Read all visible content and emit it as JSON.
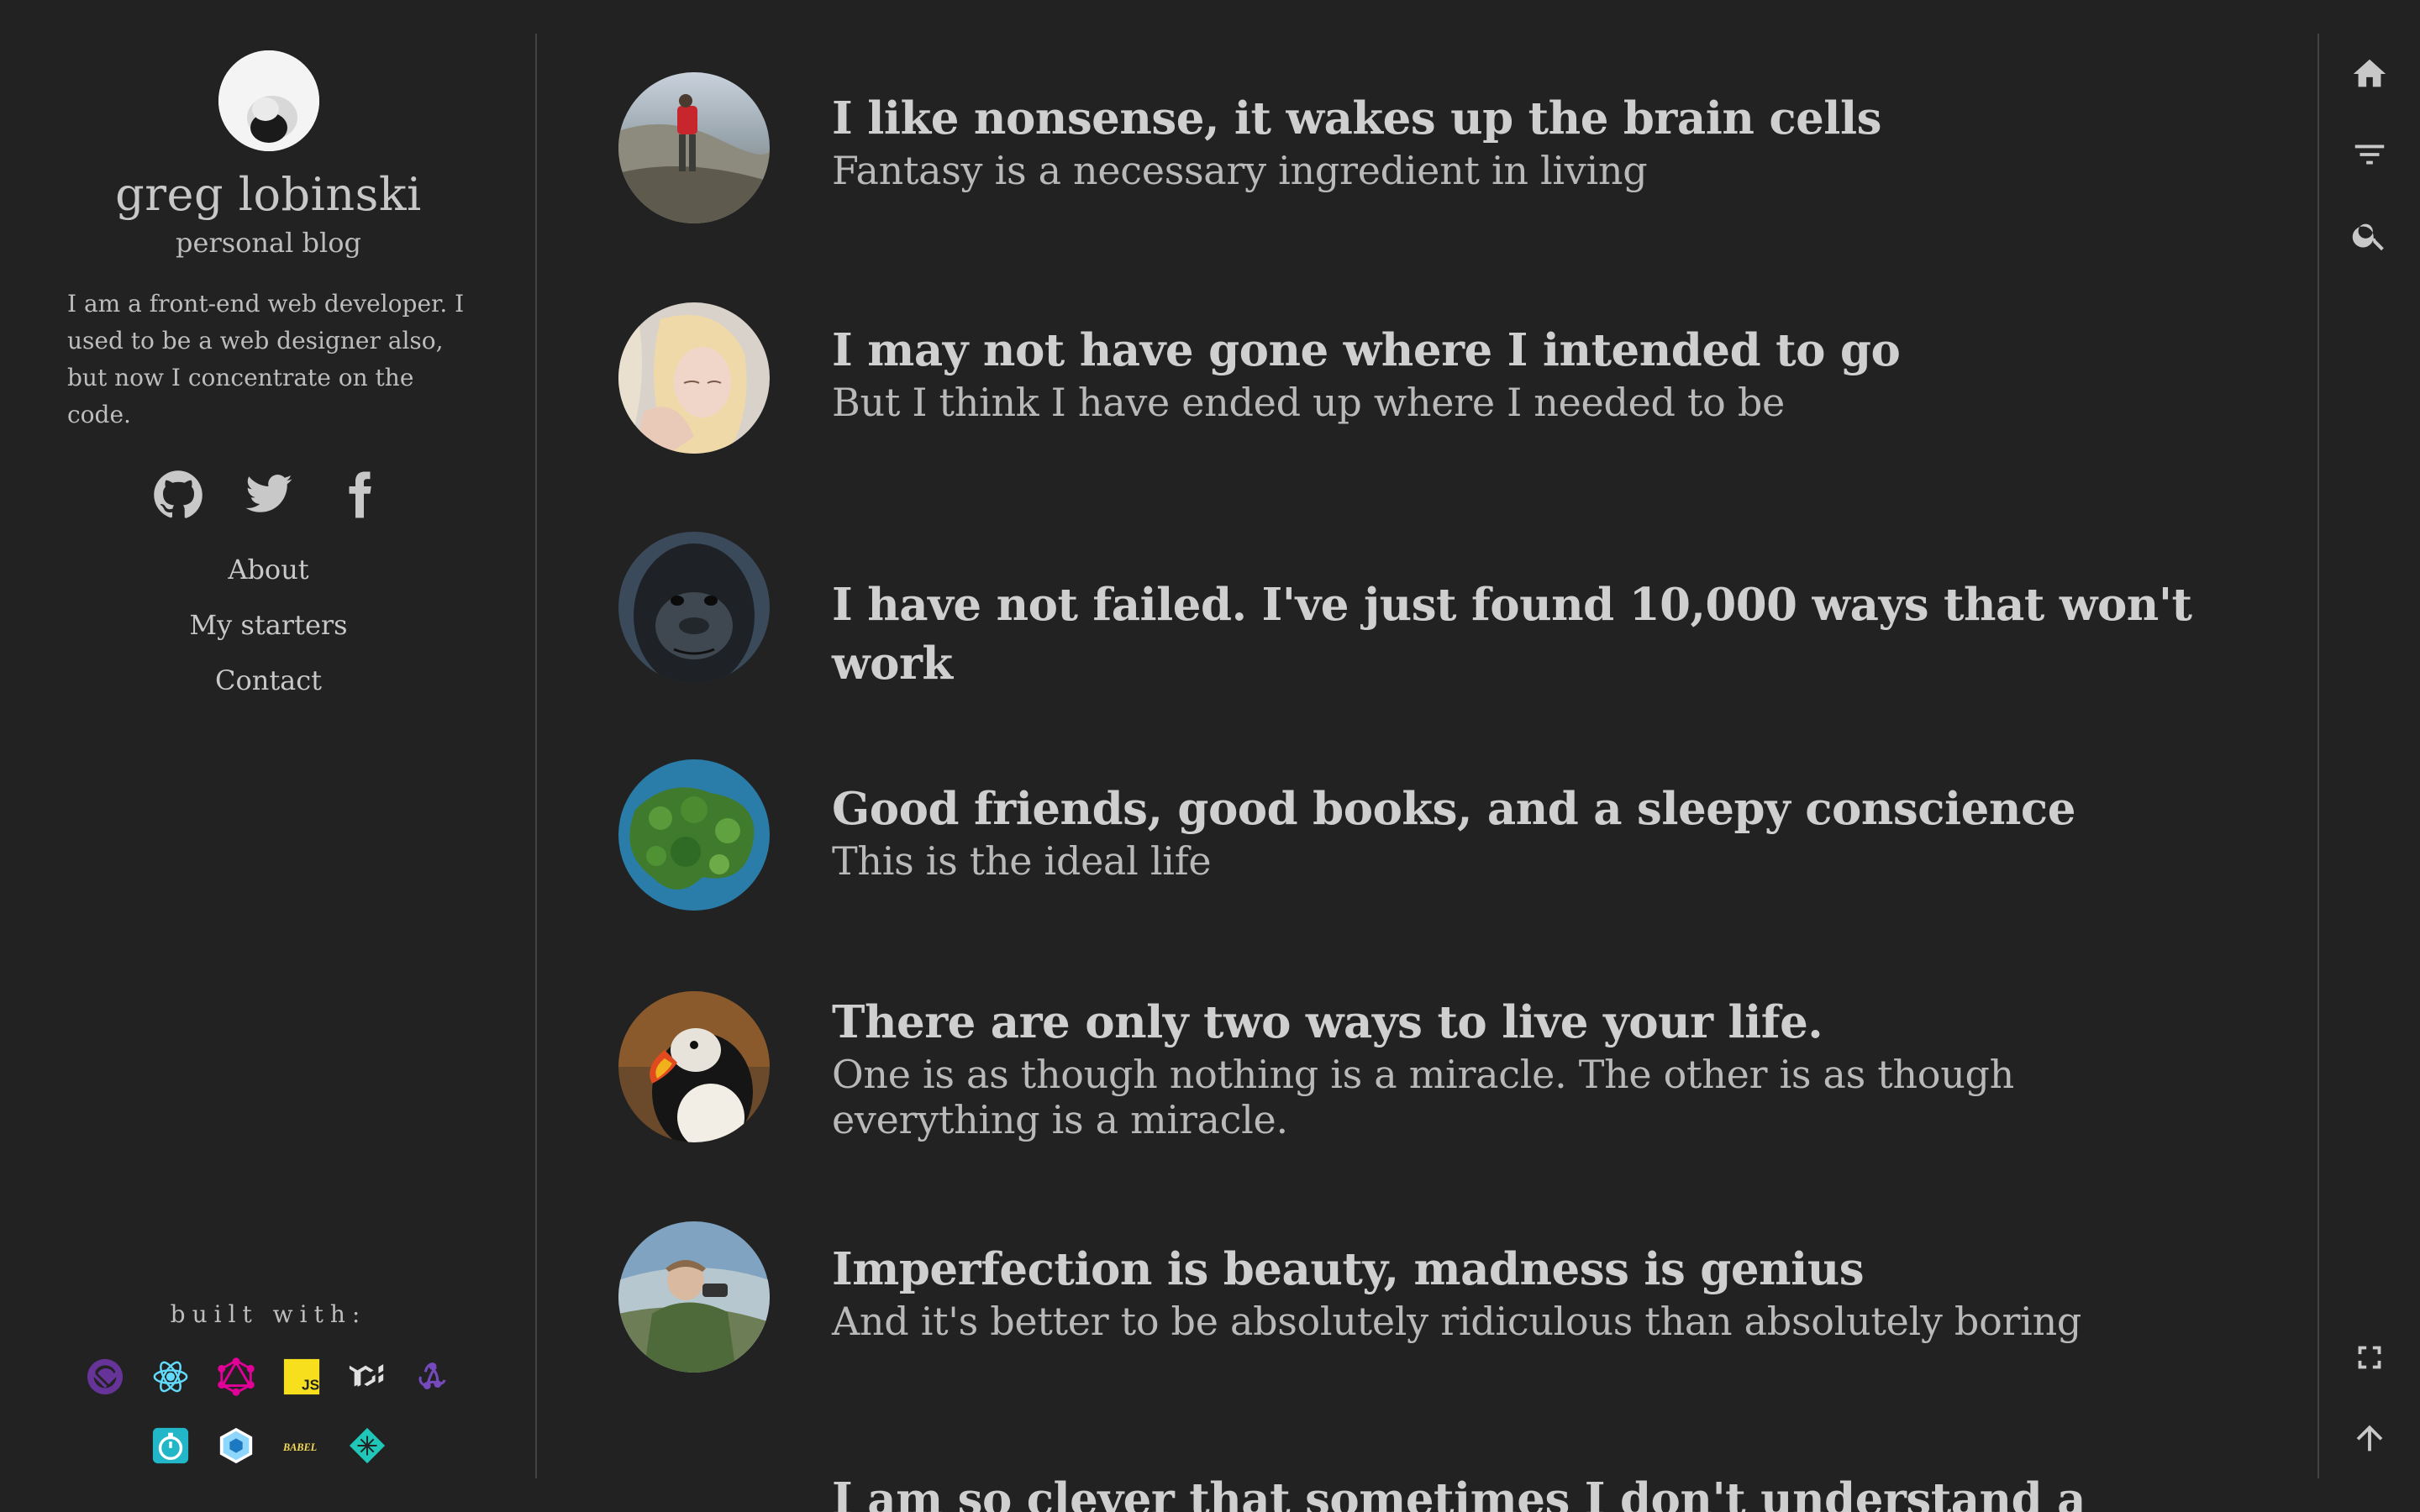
{
  "profile": {
    "name": "greg lobinski",
    "subtitle": "personal blog",
    "intro": "I am a front-end web developer. I used to be a web designer also, but now I concentrate on the code."
  },
  "social": [
    {
      "name": "github",
      "icon": "github-icon"
    },
    {
      "name": "twitter",
      "icon": "twitter-icon"
    },
    {
      "name": "facebook",
      "icon": "facebook-icon"
    }
  ],
  "nav": {
    "about": "About",
    "starters": "My starters",
    "contact": "Contact"
  },
  "built_with": {
    "label": "built with:",
    "icons": [
      "gatsby-icon",
      "react-icon",
      "graphql-icon",
      "javascript-icon",
      "material-ui-icon",
      "redux-icon",
      "jest-icon",
      "webpack-icon",
      "babel-icon",
      "netlify-icon"
    ],
    "js_text": "JS",
    "babel_text": "BABEL"
  },
  "posts": [
    {
      "title": "I like nonsense, it wakes up the brain cells",
      "subtitle": "Fantasy is a necessary ingredient in living",
      "thumb": "hiker-thumb"
    },
    {
      "title": "I may not have gone where I intended to go",
      "subtitle": "But I think I have ended up where I needed to be",
      "thumb": "girl-thumb"
    },
    {
      "title": "I have not failed. I've just found 10,000 ways that won't work",
      "subtitle": "",
      "thumb": "gorilla-thumb"
    },
    {
      "title": "Good friends, good books, and a sleepy conscience",
      "subtitle": "This is the ideal life",
      "thumb": "island-thumb"
    },
    {
      "title": "There are only two ways to live your life.",
      "subtitle": "One is as though nothing is a miracle. The other is as though everything is a miracle.",
      "thumb": "puffin-thumb"
    },
    {
      "title": "Imperfection is beauty, madness is genius",
      "subtitle": "And it's better to be absolutely ridiculous than absolutely boring",
      "thumb": "man-thumb"
    },
    {
      "title": "I am so clever that sometimes I don't understand a single word of",
      "subtitle": "",
      "thumb": ""
    }
  ],
  "toolbar": {
    "icons": [
      "home-icon",
      "filter-icon",
      "search-icon",
      "fullscreen-icon",
      "arrow-up-icon"
    ]
  },
  "colors": {
    "background": "#222222",
    "text": "#c8c8c8",
    "divider": "#444444"
  }
}
